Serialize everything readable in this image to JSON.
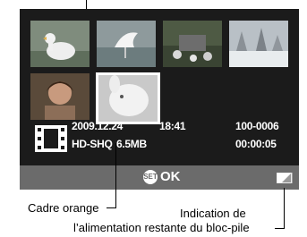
{
  "file": {
    "date": "2009.12.24",
    "time": "18:41",
    "number": "100-0006",
    "mode": "HD-SHQ",
    "size": "6.5MB",
    "duration": "00:00:05"
  },
  "controls": {
    "set_label": "SET",
    "ok_label": "OK"
  },
  "callouts": {
    "orange_frame": "Cadre orange",
    "battery_line1": "Indication de",
    "battery_line2": "l’alimentation restante du bloc-pile"
  },
  "thumbnails": [
    {
      "name": "thumb-duck"
    },
    {
      "name": "thumb-egret"
    },
    {
      "name": "thumb-flowers"
    },
    {
      "name": "thumb-snow-trees"
    },
    {
      "name": "thumb-child"
    },
    {
      "name": "thumb-bunny"
    }
  ],
  "icons": {
    "movie": "film-strip-icon",
    "battery": "battery-icon"
  }
}
